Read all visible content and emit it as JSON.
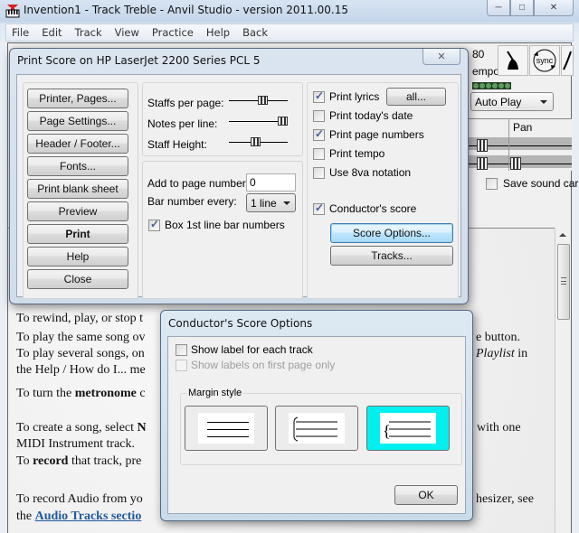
{
  "window": {
    "title": "Invention1 - Track Treble - Anvil Studio - version 2011.00.15",
    "icon": "anvil-studio-icon",
    "controls": {
      "minimize": "minimize-icon",
      "maximize": "maximize-icon",
      "close": "close-icon"
    }
  },
  "menu": {
    "items": [
      "File",
      "Edit",
      "Track",
      "View",
      "Practice",
      "Help",
      "Back"
    ]
  },
  "toolbar": {
    "tempo_value": "80",
    "tempo_label": "empo",
    "autoplay_selected": "Auto Play",
    "metronome_icon": "metronome-icon",
    "sync_label": "sync",
    "mixer_pan_label": "Pan",
    "save_sound_card_label": "Save sound car",
    "save_sound_card_checked": false
  },
  "document": {
    "lines": [
      {
        "parts": [
          {
            "text": "To rewind, play, or stop t"
          }
        ]
      },
      {
        "parts": [
          {
            "text": "To play the same song ov"
          }
        ],
        "right": "e button."
      },
      {
        "parts": [
          {
            "text": "To play several songs, on"
          }
        ],
        "right_italic": "Playlist",
        "right_tail": " in"
      },
      {
        "parts": [
          {
            "text": "the Help / How do I... me"
          }
        ]
      },
      {
        "parts": [
          {
            "text": "To turn the "
          },
          {
            "text": "metronome",
            "bold": true
          },
          {
            "text": " c"
          }
        ]
      },
      {
        "parts": [
          {
            "text": "To create a song, select "
          },
          {
            "text": "N",
            "bold": true
          }
        ],
        "right": "with one"
      },
      {
        "parts": [
          {
            "text": "MIDI Instrument track."
          }
        ]
      },
      {
        "parts": [
          {
            "text": "To "
          },
          {
            "text": "record",
            "bold": true
          },
          {
            "text": " that track, pre"
          }
        ]
      },
      {
        "parts": [
          {
            "text": "To record Audio from yo"
          }
        ],
        "right": "hesizer, see"
      },
      {
        "parts": [
          {
            "text": "the "
          },
          {
            "text": "Audio Tracks sectio",
            "link": true
          }
        ]
      }
    ]
  },
  "print_dialog": {
    "title": "Print Score on HP LaserJet 2200 Series PCL 5",
    "buttons": [
      "Printer, Pages...",
      "Page Settings...",
      "Header / Footer...",
      "Fonts...",
      "Print blank sheet",
      "Preview",
      "Print",
      "Help",
      "Close"
    ],
    "sliders": [
      {
        "label": "Staffs per page:",
        "value_fraction": 0.6
      },
      {
        "label": "Notes per line:",
        "value_fraction": 1.0
      },
      {
        "label": "Staff Height:",
        "value_fraction": 0.45
      }
    ],
    "add_to_page_numbers_label": "Add to page numbers",
    "add_to_page_numbers_value": "0",
    "bar_number_every_label": "Bar number every:",
    "bar_number_every_value": "1 line",
    "box_first_line_label": "Box 1st line bar numbers",
    "box_first_line_checked": true,
    "options": [
      {
        "label": "Print lyrics",
        "checked": true
      },
      {
        "label": "Print today's date",
        "checked": false
      },
      {
        "label": "Print page numbers",
        "checked": true
      },
      {
        "label": "Print tempo",
        "checked": false
      },
      {
        "label": "Use 8va notation",
        "checked": false
      }
    ],
    "lyrics_all_button": "all...",
    "conductors_score_label": "Conductor's score",
    "conductors_score_checked": true,
    "score_options_button": "Score Options...",
    "tracks_button": "Tracks..."
  },
  "conductor_dialog": {
    "title": "Conductor's Score Options",
    "show_label_each_track": "Show label for each track",
    "show_label_each_track_checked": false,
    "show_labels_first_page": "Show labels on first page only",
    "show_labels_first_page_checked": false,
    "show_labels_first_page_disabled": true,
    "margin_style_label": "Margin style",
    "margin_styles": [
      {
        "name": "none",
        "selected": false
      },
      {
        "name": "bracket",
        "selected": false
      },
      {
        "name": "brace",
        "selected": true
      }
    ],
    "selected_color": "#00f0f0",
    "ok_button": "OK"
  }
}
